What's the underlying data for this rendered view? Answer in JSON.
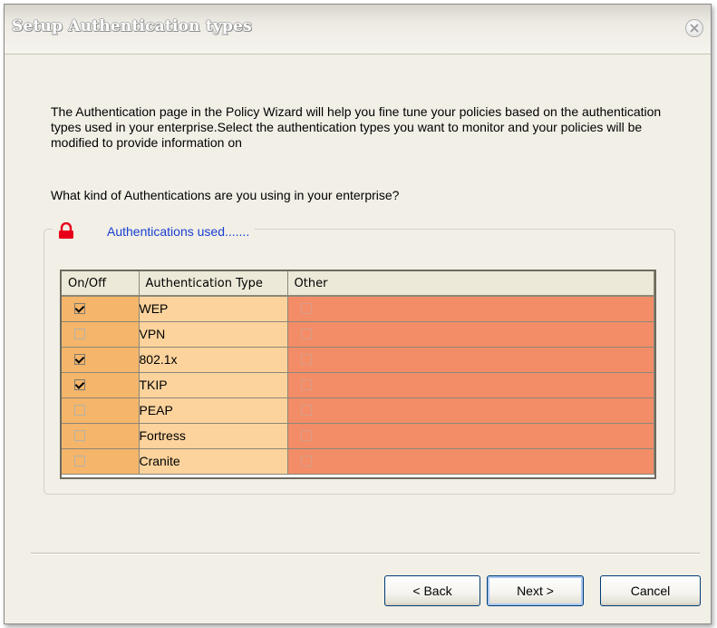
{
  "window": {
    "title": "Setup Authentication types"
  },
  "intro_text": "The Authentication  page in the Policy Wizard will help you fine tune your policies based on the authentication types used in your enterprise.Select the authentication types you want to monitor and your policies will be modified to provide information on",
  "question": "What kind of Authentications are you using in your enterprise?",
  "group": {
    "label": "Authentications used......."
  },
  "table": {
    "headers": [
      "On/Off",
      "Authentication Type",
      "Other"
    ],
    "rows": [
      {
        "type": "WEP",
        "on": true,
        "other": false
      },
      {
        "type": "VPN",
        "on": false,
        "other": false
      },
      {
        "type": "802.1x",
        "on": true,
        "other": false
      },
      {
        "type": "TKIP",
        "on": true,
        "other": false
      },
      {
        "type": "PEAP",
        "on": false,
        "other": false
      },
      {
        "type": "Fortress",
        "on": false,
        "other": false
      },
      {
        "type": "Cranite",
        "on": false,
        "other": false
      }
    ]
  },
  "buttons": {
    "back": "< Back",
    "next": "Next >",
    "cancel": "Cancel"
  },
  "colors": {
    "onoff_column": "#f5b56a",
    "type_column": "#fcd39d",
    "other_column": "#f28d68",
    "legend_text": "#1a3fd1",
    "lock_icon": "#e8001a"
  },
  "icons": {
    "close": "close-icon",
    "legend": "lock-icon"
  }
}
